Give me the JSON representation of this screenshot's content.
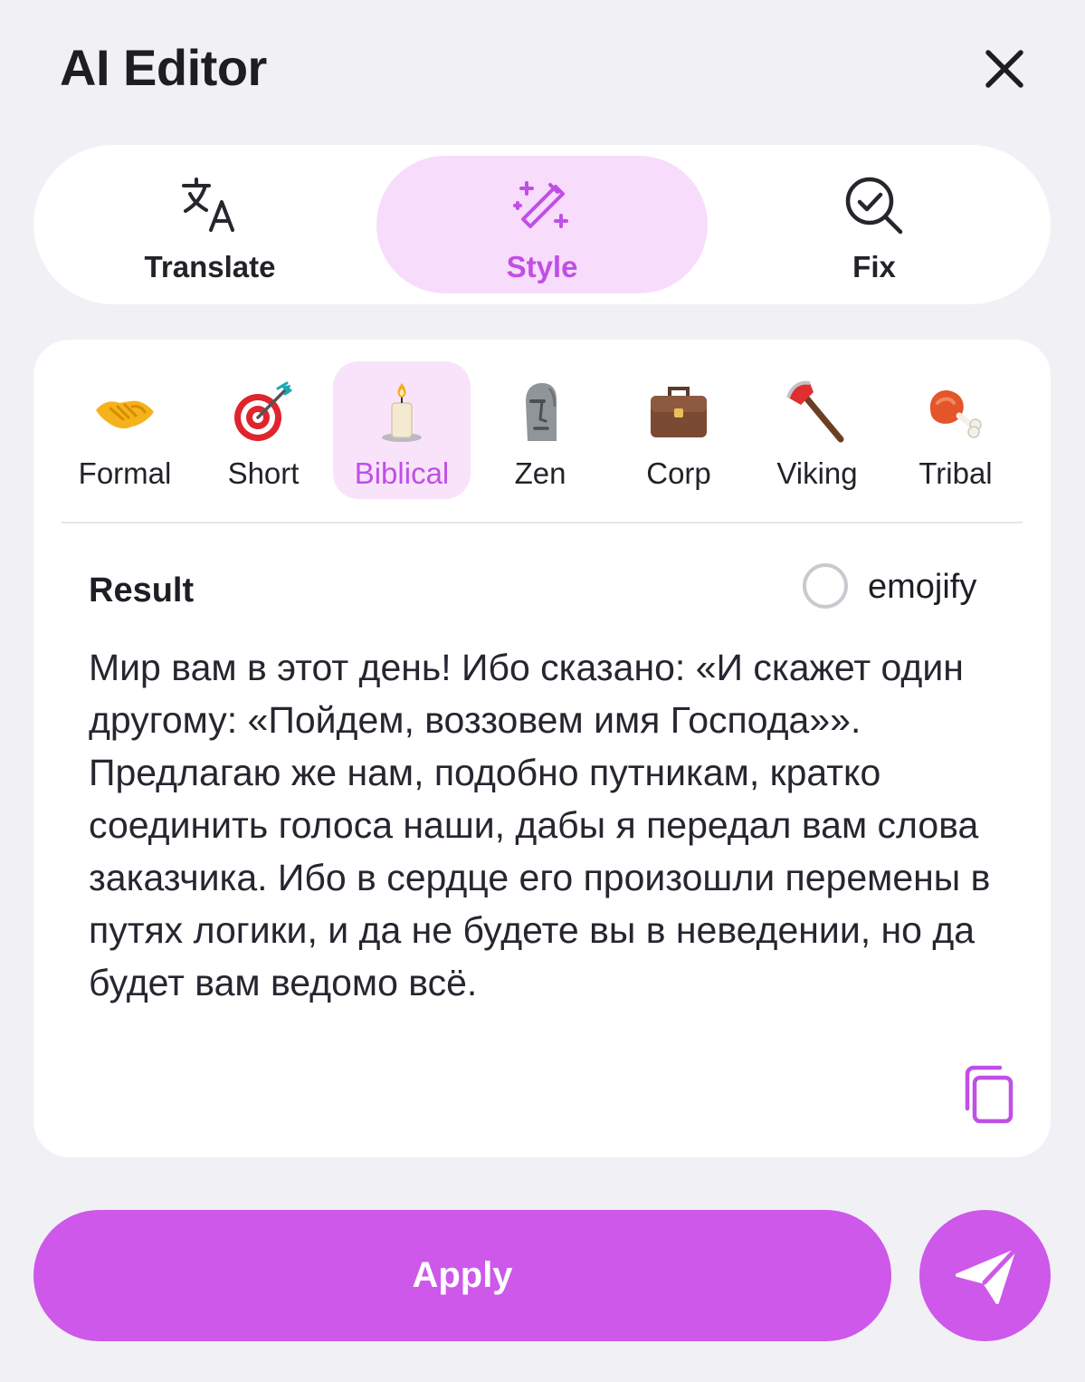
{
  "header": {
    "title": "AI Editor"
  },
  "mode_tabs": [
    {
      "label": "Translate",
      "icon": "translate-icon",
      "active": false
    },
    {
      "label": "Style",
      "icon": "magic-wand-icon",
      "active": true
    },
    {
      "label": "Fix",
      "icon": "check-search-icon",
      "active": false
    }
  ],
  "styles": [
    {
      "label": "Formal",
      "icon": "handshake-emoji",
      "active": false
    },
    {
      "label": "Short",
      "icon": "direct-hit-emoji",
      "active": false
    },
    {
      "label": "Biblical",
      "icon": "candle-emoji",
      "active": true
    },
    {
      "label": "Zen",
      "icon": "moai-emoji",
      "active": false
    },
    {
      "label": "Corp",
      "icon": "briefcase-emoji",
      "active": false
    },
    {
      "label": "Viking",
      "icon": "axe-emoji",
      "active": false
    },
    {
      "label": "Tribal",
      "icon": "meat-on-bone-emoji",
      "active": false
    }
  ],
  "result": {
    "label": "Result",
    "emojify_label": "emojify",
    "emojify_checked": false,
    "text": "Мир вам в этот день! Ибо сказано: «И скажет один другому: «Пойдем, воззовем имя Господа»». Предлагаю же нам, подобно путникам, кратко соединить голоса наши, дабы я передал вам слова заказчика. Ибо в сердце его произошли перемены в путях логики, и да не будете вы в неведении, но да будет вам ведомо всё."
  },
  "actions": {
    "apply_label": "Apply",
    "send_icon": "send-icon"
  },
  "colors": {
    "accent": "#cd58ea",
    "accent_text": "#c04fe6",
    "active_tab_bg": "#f8dcfb",
    "background": "#f1f0f5"
  }
}
